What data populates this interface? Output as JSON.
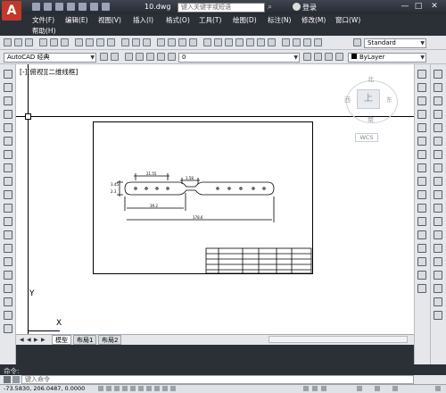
{
  "title_bar": {
    "doc_title": "10.dwg",
    "search_placeholder": "键入关键字或短语",
    "login_label": "登录",
    "logo": "A",
    "controls": [
      "—",
      "□",
      "✕"
    ]
  },
  "menu": {
    "items": [
      "文件(F)",
      "编辑(E)",
      "视图(V)",
      "插入(I)",
      "格式(O)",
      "工具(T)",
      "绘图(D)",
      "标注(N)",
      "修改(M)",
      "窗口(W)",
      "帮助(H)"
    ]
  },
  "toolbar": {
    "text_style_value": "Standard",
    "workspace_value": "AutoCAD 经典",
    "layer_value": "0",
    "color_value": "ByLayer"
  },
  "viewport": {
    "label": "[-][俯视][二维线框]",
    "viewcube": {
      "top": "上",
      "north": "北",
      "south": "南",
      "east": "东",
      "west": "西",
      "wcs": "WCS"
    },
    "ucs": {
      "x": "X",
      "y": "Y"
    }
  },
  "drawing": {
    "dim_top_left": "21.55",
    "dim_top_right": "1.58",
    "dim_left_1": "3.45",
    "dim_left_2": "2.3",
    "dim_mid": "39.2",
    "dim_overall": "178.6"
  },
  "tabs": [
    "模型",
    "布局1",
    "布局2"
  ],
  "command": {
    "history_label": "命令:",
    "input_placeholder": "键入命令"
  },
  "status": {
    "coords": "-73.5830, 206.0487, 0.0000"
  }
}
